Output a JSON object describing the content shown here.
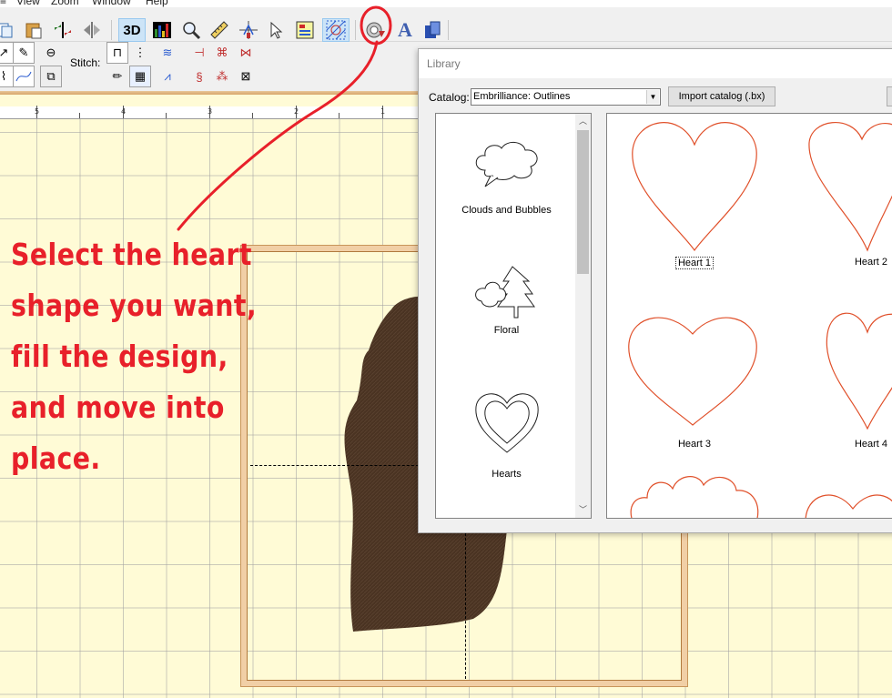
{
  "menu": {
    "items": [
      "View",
      "Zoom",
      "Window",
      "Help"
    ]
  },
  "toolbar": {
    "row1_icons": [
      "copy-icon",
      "paste-icon",
      "mirror-horizontal-icon",
      "mirror-vertical-icon",
      "3d-view-icon",
      "color-icon",
      "zoom-icon",
      "measure-icon",
      "reference-point-icon",
      "select-icon",
      "properties-icon",
      "hoop-icon",
      "library-icon",
      "text-icon",
      "monogram-icon"
    ],
    "three_d_label": "3D",
    "text_icon_label": "A",
    "stitch_label": "Stitch:"
  },
  "ruler": {
    "labels": [
      "5",
      "4",
      "3",
      "2",
      "1"
    ]
  },
  "annotation": {
    "lines": [
      "Select the heart",
      "shape you want,",
      "fill the design,",
      "and move into",
      "place."
    ]
  },
  "library": {
    "title": "Library",
    "catalog_label": "Catalog:",
    "catalog_value": "Embrilliance: Outlines",
    "import_button": "Import catalog (.bx)",
    "categories": [
      {
        "label": "Clouds and Bubbles",
        "icon": "cloud-bubble-icon"
      },
      {
        "label": "Floral",
        "icon": "floral-icon"
      },
      {
        "label": "Hearts",
        "icon": "hearts-icon"
      }
    ],
    "shapes": [
      {
        "label": "Heart 1",
        "selected": true
      },
      {
        "label": "Heart 2",
        "selected": false
      },
      {
        "label": "Heart 3",
        "selected": false
      },
      {
        "label": "Heart 4",
        "selected": false
      }
    ]
  },
  "colors": {
    "annotation": "#e8202a",
    "shape_outline": "#e0502a",
    "fill": "#4a3322",
    "canvas": "#fffbd6",
    "hoop": "#f1cfa6"
  }
}
